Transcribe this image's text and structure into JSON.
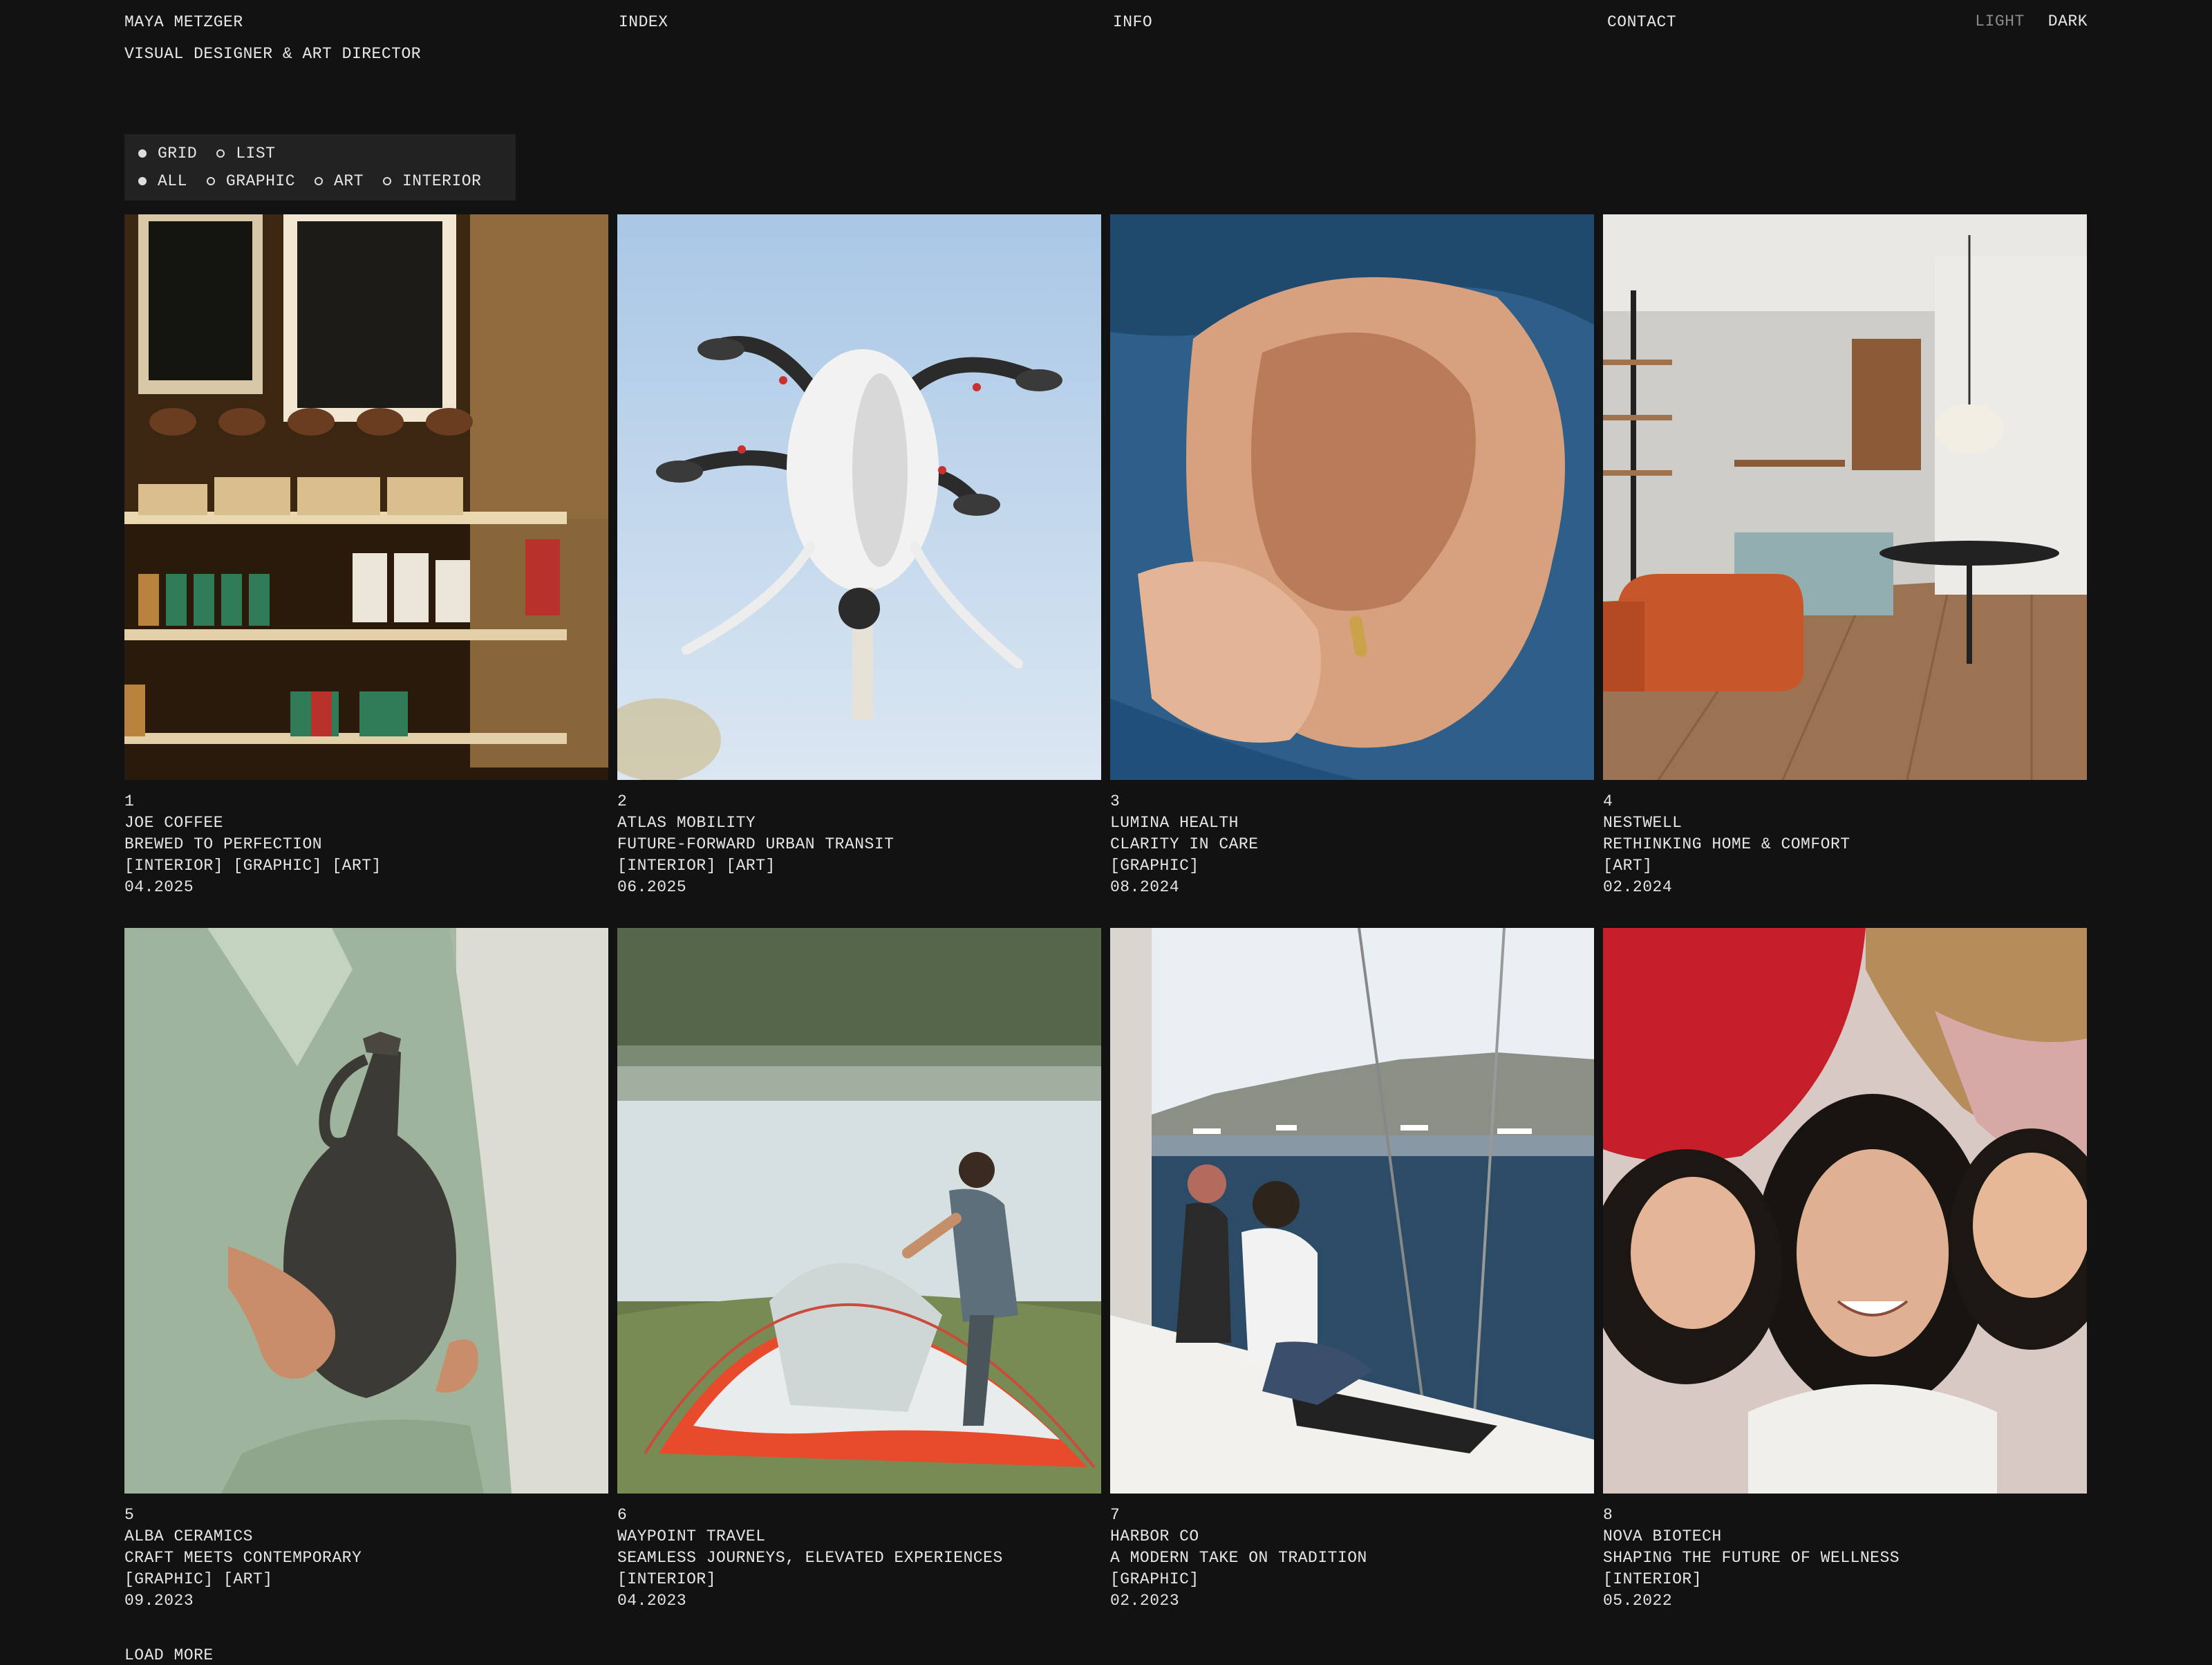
{
  "header": {
    "name": "MAYA METZGER",
    "subtitle": "VISUAL DESIGNER & ART DIRECTOR",
    "nav": [
      "INDEX",
      "INFO",
      "CONTACT"
    ],
    "theme": {
      "light": "LIGHT",
      "dark": "DARK"
    }
  },
  "view_toggle": {
    "options": [
      "GRID",
      "LIST"
    ],
    "selected": "GRID"
  },
  "filters": {
    "options": [
      "ALL",
      "GRAPHIC",
      "ART",
      "INTERIOR"
    ],
    "selected": "ALL"
  },
  "projects": [
    {
      "num": "1",
      "title": "JOE COFFEE",
      "tagline": "BREWED TO PERFECTION",
      "tags": "[INTERIOR] [GRAPHIC] [ART]",
      "date": "04.2025",
      "image": "coffee-shop-shelves"
    },
    {
      "num": "2",
      "title": "ATLAS MOBILITY",
      "tagline": "FUTURE-FORWARD URBAN TRANSIT",
      "tags": "[INTERIOR] [ART]",
      "date": "06.2025",
      "image": "white-drone-sky"
    },
    {
      "num": "3",
      "title": "LUMINA HEALTH",
      "tagline": "CLARITY IN CARE",
      "tags": "[GRAPHIC]",
      "date": "08.2024",
      "image": "holding-hands"
    },
    {
      "num": "4",
      "title": "NESTWELL",
      "tagline": "RETHINKING HOME & COMFORT",
      "tags": "[ART]",
      "date": "02.2024",
      "image": "modern-kitchen-interior"
    },
    {
      "num": "5",
      "title": "ALBA CERAMICS",
      "tagline": "CRAFT MEETS CONTEMPORARY",
      "tags": "[GRAPHIC] [ART]",
      "date": "09.2023",
      "image": "ceramic-vase"
    },
    {
      "num": "6",
      "title": "WAYPOINT TRAVEL",
      "tagline": "SEAMLESS JOURNEYS, ELEVATED EXPERIENCES",
      "tags": "[INTERIOR]",
      "date": "04.2023",
      "image": "tent-by-lake"
    },
    {
      "num": "7",
      "title": "HARBOR CO",
      "tagline": "A MODERN TAKE ON TRADITION",
      "tags": "[GRAPHIC]",
      "date": "02.2023",
      "image": "sailboat-harbor"
    },
    {
      "num": "8",
      "title": "NOVA BIOTECH",
      "tagline": "SHAPING THE FUTURE OF WELLNESS",
      "tags": "[INTERIOR]",
      "date": "05.2022",
      "image": "family-portrait"
    }
  ],
  "load_more": "LOAD MORE"
}
